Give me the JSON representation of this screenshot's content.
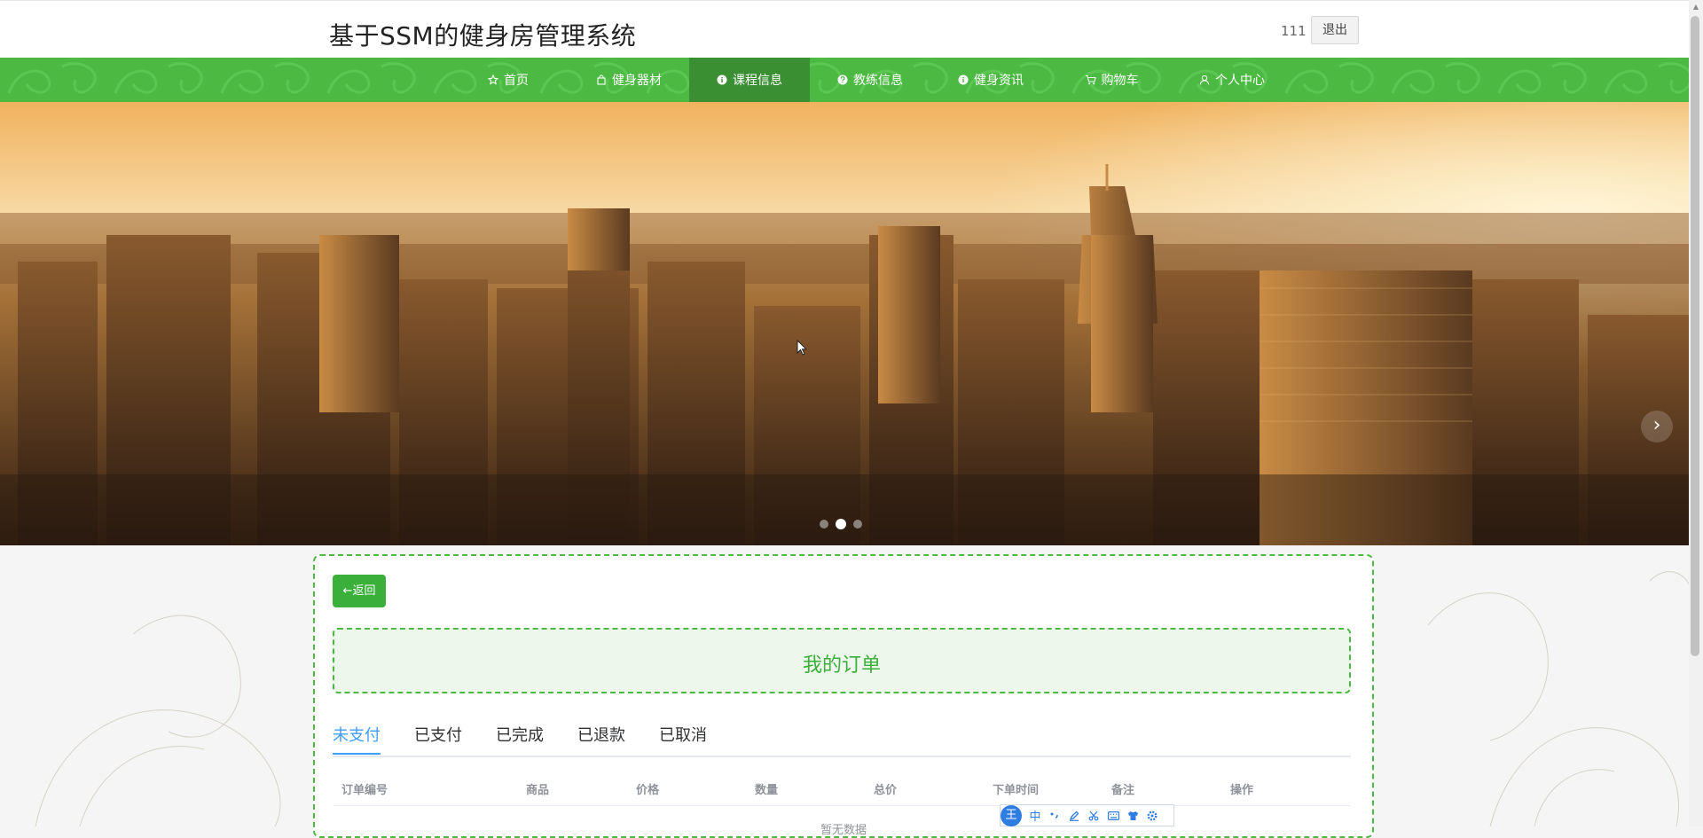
{
  "header": {
    "title": "基于SSM的健身房管理系统",
    "username": "111",
    "logout_label": "退出"
  },
  "nav": {
    "items": [
      {
        "label": "首页",
        "icon": "star-icon"
      },
      {
        "label": "健身器材",
        "icon": "bag-icon"
      },
      {
        "label": "课程信息",
        "icon": "info-icon",
        "active": true
      },
      {
        "label": "教练信息",
        "icon": "help-icon"
      },
      {
        "label": "健身资讯",
        "icon": "info-icon"
      },
      {
        "label": "购物车",
        "icon": "cart-icon"
      },
      {
        "label": "个人中心",
        "icon": "user-icon"
      }
    ]
  },
  "banner": {
    "next_glyph": "›",
    "slides_count": 3,
    "active_slide": 2
  },
  "main": {
    "back_label": "←返回",
    "page_title": "我的订单",
    "tabs": [
      {
        "label": "未支付",
        "active": true
      },
      {
        "label": "已支付"
      },
      {
        "label": "已完成"
      },
      {
        "label": "已退款"
      },
      {
        "label": "已取消"
      }
    ],
    "columns": [
      "订单编号",
      "商品",
      "价格",
      "数量",
      "总价",
      "下单时间",
      "备注",
      "操作"
    ],
    "empty_text": "暂无数据"
  },
  "ime_toolbar": {
    "logo": "王",
    "mode": "中",
    "items": [
      "punctuation-icon",
      "pen-icon",
      "scissors-icon",
      "keyboard-icon",
      "skin-icon",
      "settings-icon"
    ]
  },
  "colors": {
    "nav_green": "#4cb943",
    "nav_active": "#3a8f33",
    "accent_green": "#3ab03a",
    "tab_active_blue": "#409eff"
  }
}
